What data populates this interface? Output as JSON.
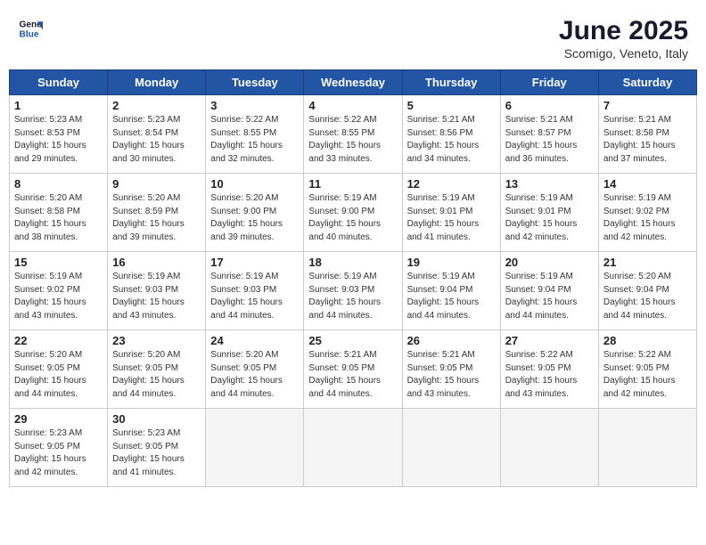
{
  "header": {
    "logo_line1": "General",
    "logo_line2": "Blue",
    "title": "June 2025",
    "subtitle": "Scomigo, Veneto, Italy"
  },
  "columns": [
    "Sunday",
    "Monday",
    "Tuesday",
    "Wednesday",
    "Thursday",
    "Friday",
    "Saturday"
  ],
  "weeks": [
    [
      {
        "day": "1",
        "sunrise": "5:23 AM",
        "sunset": "8:53 PM",
        "daylight": "15 hours and 29 minutes."
      },
      {
        "day": "2",
        "sunrise": "5:23 AM",
        "sunset": "8:54 PM",
        "daylight": "15 hours and 30 minutes."
      },
      {
        "day": "3",
        "sunrise": "5:22 AM",
        "sunset": "8:55 PM",
        "daylight": "15 hours and 32 minutes."
      },
      {
        "day": "4",
        "sunrise": "5:22 AM",
        "sunset": "8:55 PM",
        "daylight": "15 hours and 33 minutes."
      },
      {
        "day": "5",
        "sunrise": "5:21 AM",
        "sunset": "8:56 PM",
        "daylight": "15 hours and 34 minutes."
      },
      {
        "day": "6",
        "sunrise": "5:21 AM",
        "sunset": "8:57 PM",
        "daylight": "15 hours and 36 minutes."
      },
      {
        "day": "7",
        "sunrise": "5:21 AM",
        "sunset": "8:58 PM",
        "daylight": "15 hours and 37 minutes."
      }
    ],
    [
      {
        "day": "8",
        "sunrise": "5:20 AM",
        "sunset": "8:58 PM",
        "daylight": "15 hours and 38 minutes."
      },
      {
        "day": "9",
        "sunrise": "5:20 AM",
        "sunset": "8:59 PM",
        "daylight": "15 hours and 39 minutes."
      },
      {
        "day": "10",
        "sunrise": "5:20 AM",
        "sunset": "9:00 PM",
        "daylight": "15 hours and 39 minutes."
      },
      {
        "day": "11",
        "sunrise": "5:19 AM",
        "sunset": "9:00 PM",
        "daylight": "15 hours and 40 minutes."
      },
      {
        "day": "12",
        "sunrise": "5:19 AM",
        "sunset": "9:01 PM",
        "daylight": "15 hours and 41 minutes."
      },
      {
        "day": "13",
        "sunrise": "5:19 AM",
        "sunset": "9:01 PM",
        "daylight": "15 hours and 42 minutes."
      },
      {
        "day": "14",
        "sunrise": "5:19 AM",
        "sunset": "9:02 PM",
        "daylight": "15 hours and 42 minutes."
      }
    ],
    [
      {
        "day": "15",
        "sunrise": "5:19 AM",
        "sunset": "9:02 PM",
        "daylight": "15 hours and 43 minutes."
      },
      {
        "day": "16",
        "sunrise": "5:19 AM",
        "sunset": "9:03 PM",
        "daylight": "15 hours and 43 minutes."
      },
      {
        "day": "17",
        "sunrise": "5:19 AM",
        "sunset": "9:03 PM",
        "daylight": "15 hours and 44 minutes."
      },
      {
        "day": "18",
        "sunrise": "5:19 AM",
        "sunset": "9:03 PM",
        "daylight": "15 hours and 44 minutes."
      },
      {
        "day": "19",
        "sunrise": "5:19 AM",
        "sunset": "9:04 PM",
        "daylight": "15 hours and 44 minutes."
      },
      {
        "day": "20",
        "sunrise": "5:19 AM",
        "sunset": "9:04 PM",
        "daylight": "15 hours and 44 minutes."
      },
      {
        "day": "21",
        "sunrise": "5:20 AM",
        "sunset": "9:04 PM",
        "daylight": "15 hours and 44 minutes."
      }
    ],
    [
      {
        "day": "22",
        "sunrise": "5:20 AM",
        "sunset": "9:05 PM",
        "daylight": "15 hours and 44 minutes."
      },
      {
        "day": "23",
        "sunrise": "5:20 AM",
        "sunset": "9:05 PM",
        "daylight": "15 hours and 44 minutes."
      },
      {
        "day": "24",
        "sunrise": "5:20 AM",
        "sunset": "9:05 PM",
        "daylight": "15 hours and 44 minutes."
      },
      {
        "day": "25",
        "sunrise": "5:21 AM",
        "sunset": "9:05 PM",
        "daylight": "15 hours and 44 minutes."
      },
      {
        "day": "26",
        "sunrise": "5:21 AM",
        "sunset": "9:05 PM",
        "daylight": "15 hours and 43 minutes."
      },
      {
        "day": "27",
        "sunrise": "5:22 AM",
        "sunset": "9:05 PM",
        "daylight": "15 hours and 43 minutes."
      },
      {
        "day": "28",
        "sunrise": "5:22 AM",
        "sunset": "9:05 PM",
        "daylight": "15 hours and 42 minutes."
      }
    ],
    [
      {
        "day": "29",
        "sunrise": "5:23 AM",
        "sunset": "9:05 PM",
        "daylight": "15 hours and 42 minutes."
      },
      {
        "day": "30",
        "sunrise": "5:23 AM",
        "sunset": "9:05 PM",
        "daylight": "15 hours and 41 minutes."
      },
      null,
      null,
      null,
      null,
      null
    ]
  ]
}
